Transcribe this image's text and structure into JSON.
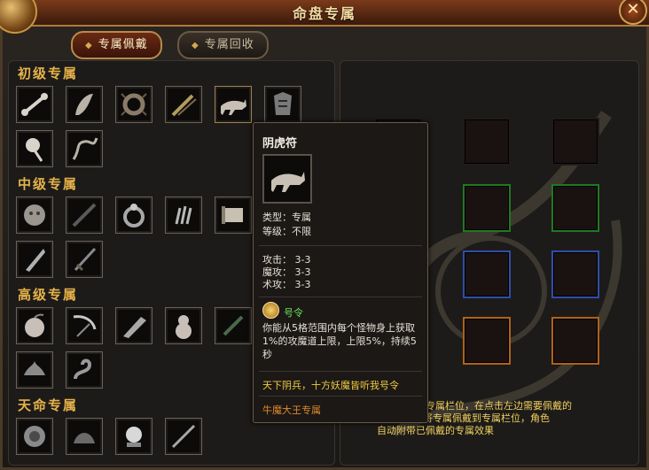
{
  "window": {
    "title": "命盘专属",
    "close_glyph": "✕"
  },
  "tabs": [
    {
      "label": "专属佩戴",
      "active": true
    },
    {
      "label": "专属回收",
      "active": false
    }
  ],
  "sections": [
    {
      "title": "初级专属",
      "items": [
        "bone-icon",
        "horn-icon",
        "beast-claw-icon",
        "sword-box-icon",
        "tiger-charm-icon",
        "demon-armor-icon",
        "orb-staff-icon",
        "whip-icon"
      ]
    },
    {
      "title": "中级专属",
      "items": [
        "skull-orb-icon",
        "black-sword-icon",
        "ring-icon",
        "claw-gauntlet-icon",
        "scroll-icon",
        "broadsword-icon",
        "long-sword-icon"
      ]
    },
    {
      "title": "高级专属",
      "items": [
        "peach-icon",
        "scythe-icon",
        "broad-blade-icon",
        "gourd-icon",
        "dagger-icon",
        "lotus-icon",
        "serpent-icon"
      ]
    },
    {
      "title": "天命专属",
      "items": [
        "medallion-icon",
        "wing-charm-icon",
        "crystal-orb-icon",
        "heavenly-sword-icon"
      ]
    }
  ],
  "equip_slots": {
    "colors": {
      "black": "#1e1b19",
      "green": "#1f7a1f",
      "blue": "#2f4ea8",
      "orange": "#b0621a"
    }
  },
  "info_text": {
    "line1": "专属栏位，在点击左边需要佩戴的",
    "line2": "即可将专属佩戴到专属栏位，角色",
    "line3": "自动附带已佩戴的专属效果"
  },
  "tooltip": {
    "name": "阴虎符",
    "icon": "tiger-charm-icon",
    "type_line": "类型：专属",
    "level_line": "等级：不限",
    "stats": [
      "攻击：  3-3",
      "魔攻：  3-3",
      "术攻：  3-3"
    ],
    "skill_name": "号令",
    "skill_desc": "你能从5格范围内每个怪物身上获取1%的攻魔道上限，上限5%，持续5秒",
    "quote": "天下阴兵，十方妖魔皆听我号令",
    "set_name": "牛魔大王专属"
  }
}
